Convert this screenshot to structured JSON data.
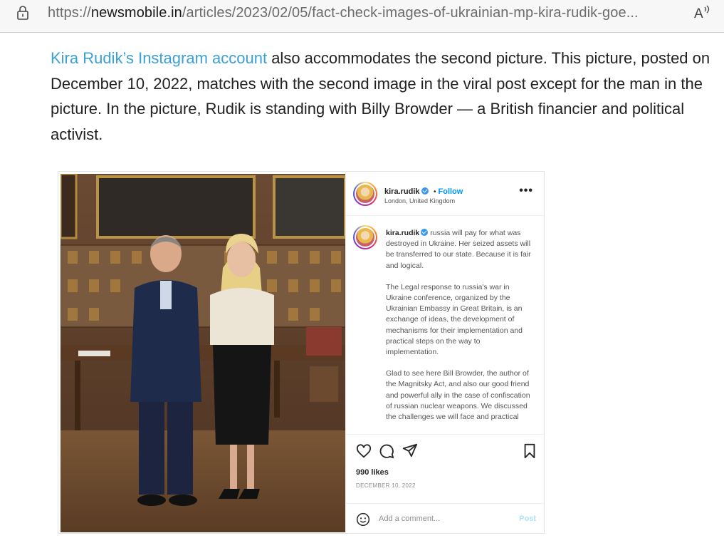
{
  "browser": {
    "url_prefix": "https://",
    "url_domain": "newsmobile.in",
    "url_path": "/articles/2023/02/05/fact-check-images-of-ukrainian-mp-kira-rudik-goe...",
    "lock_icon": "lock-icon",
    "read_aloud_icon": "read-aloud-icon"
  },
  "article": {
    "link_text": "Kira Rudik’s Instagram account",
    "paragraph_rest": " also accommodates the second picture. This picture, posted on December 10, 2022, matches with the second image in the viral post except for the man in the picture. In the picture, Rudik is standing with Billy Browder — a British financier and political activist."
  },
  "instagram": {
    "header": {
      "handle": "kira.rudik",
      "separator": "•",
      "follow": "Follow",
      "location": "London, United Kingdom",
      "more": "•••"
    },
    "caption": {
      "handle": "kira.rudik",
      "p1": " russia will pay for what was destroyed in Ukraine. Her seized assets will be transferred to our state. Because it is fair and logical.",
      "p2": "The Legal response to russia's war in Ukraine conference, organized by the Ukrainian Embassy in Great Britain, is an exchange of ideas, the development of mechanisms for their implementation and practical steps on the way to implementation.",
      "p3": "Glad to see here Bill Browder, the author of the Magnitsky Act, and also our good friend and powerful ally in the case of confiscation of russian nuclear weapons. We discussed the challenges we will face and practical"
    },
    "likes": "990 likes",
    "date": "DECEMBER 10, 2022",
    "comment_placeholder": "Add a comment...",
    "post_label": "Post",
    "colors": {
      "follow_blue": "#0095f6",
      "link_blue": "#3aa0d8",
      "post_disabled": "#b2dffc"
    },
    "icons": [
      "heart-icon",
      "comment-icon",
      "share-icon",
      "bookmark-icon",
      "emoji-icon",
      "verified-icon",
      "more-options-icon"
    ]
  }
}
